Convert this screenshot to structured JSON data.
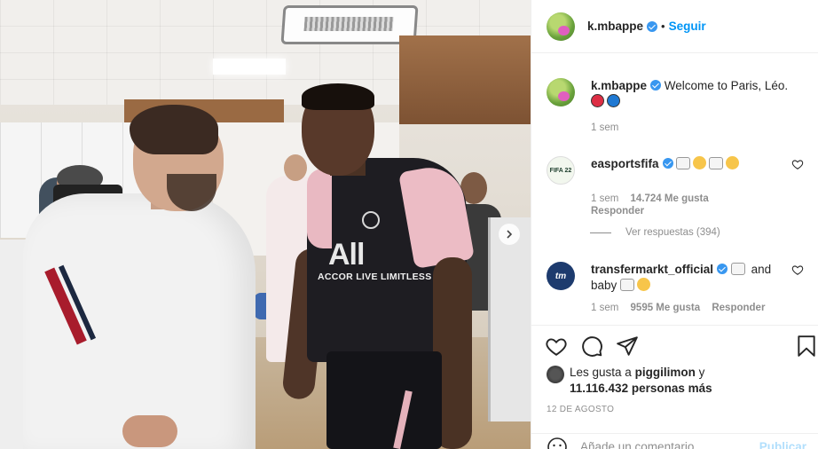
{
  "post": {
    "author": "k.mbappe",
    "follow_label": "Seguir",
    "separator": "•",
    "jersey_brand": "All",
    "jersey_sponsor": "ACCOR LIVE LIMITLESS"
  },
  "caption": {
    "username": "k.mbappe",
    "text": "Welcome to Paris, Léo.",
    "time": "1 sem"
  },
  "comments": [
    {
      "username": "easportsfifa",
      "avatar_label": "FIFA 22",
      "time": "1 sem",
      "likes": "14.724 Me gusta",
      "reply": "Responder",
      "view_replies": "Ver respuestas (394)"
    },
    {
      "username": "transfermarkt_official",
      "avatar_label": "tm",
      "text_1": "and",
      "text_2": "baby",
      "time": "1 sem",
      "likes": "9595 Me gusta",
      "reply": "Responder"
    }
  ],
  "likes": {
    "prefix": "Les gusta a",
    "user": "piggilimon",
    "connector": "y",
    "others": "11.116.432 personas más"
  },
  "date": "12 DE AGOSTO",
  "add_comment": {
    "placeholder": "Añade un comentario...",
    "post_label": "Publicar"
  },
  "colors": {
    "link": "#0095f6",
    "verified": "#3897f0",
    "muted": "#8e8e8e"
  }
}
